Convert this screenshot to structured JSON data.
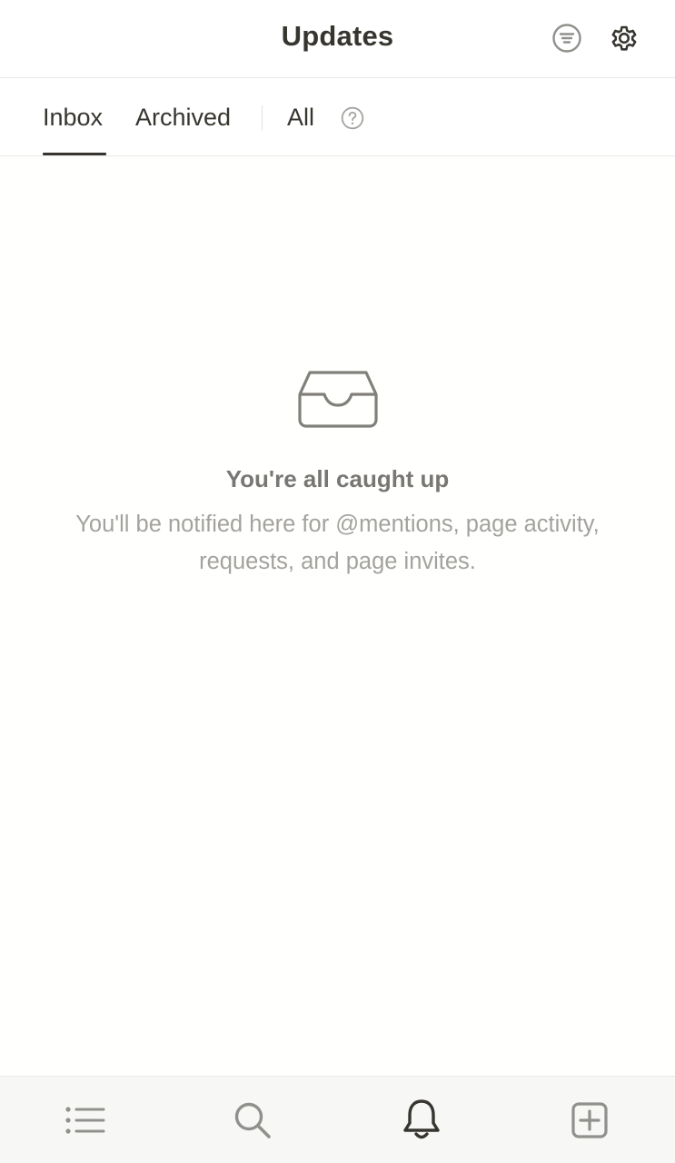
{
  "header": {
    "title": "Updates",
    "filter_icon": "filter-icon",
    "settings_icon": "gear-icon"
  },
  "tabs": {
    "items": [
      {
        "label": "Inbox",
        "active": true
      },
      {
        "label": "Archived",
        "active": false
      },
      {
        "label": "All",
        "active": false
      }
    ],
    "help_icon": "question-circle-icon"
  },
  "empty_state": {
    "icon": "inbox-tray-icon",
    "title": "You're all caught up",
    "description_line1": "You'll be notified here for @mentions, page activity,",
    "description_line2": "requests, and page invites."
  },
  "bottom_nav": {
    "items": [
      {
        "icon": "list-icon",
        "active": false
      },
      {
        "icon": "search-icon",
        "active": false
      },
      {
        "icon": "bell-icon",
        "active": true
      },
      {
        "icon": "new-page-icon",
        "active": false
      }
    ]
  },
  "colors": {
    "text_primary": "#37352f",
    "text_secondary": "#787774",
    "text_tertiary": "#a3a29e",
    "icon_muted": "#91908c",
    "divider": "#e9e9e7",
    "nav_bg": "#f7f7f5"
  }
}
